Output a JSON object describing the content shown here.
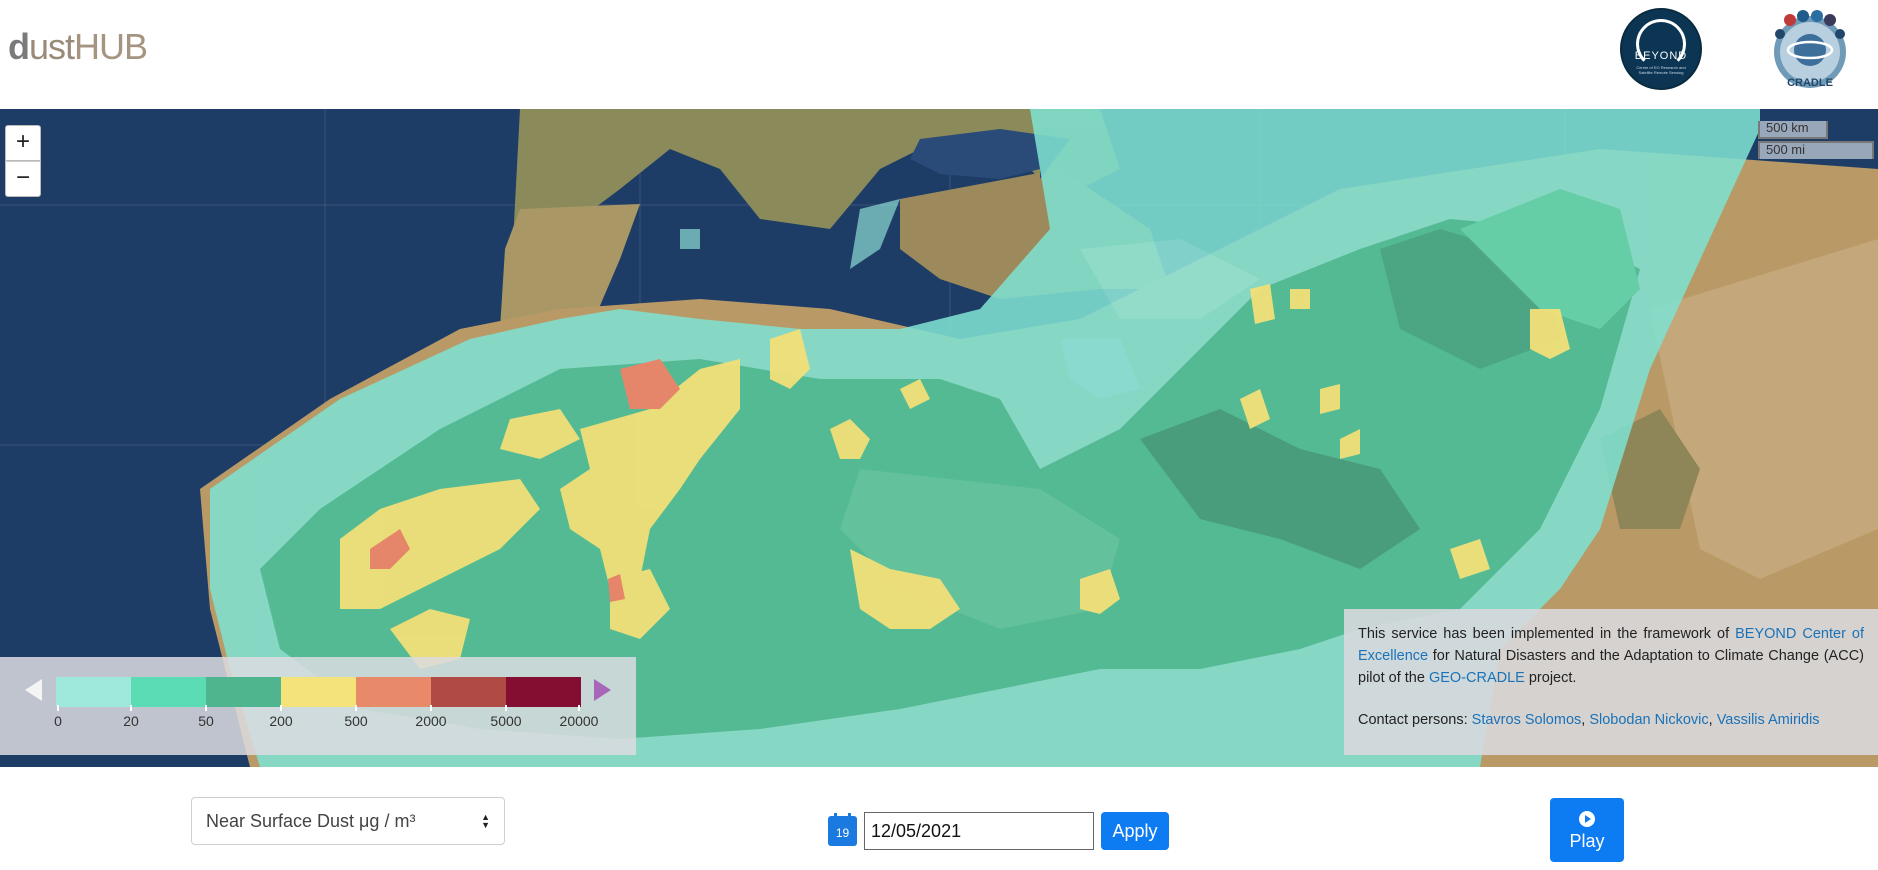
{
  "header": {
    "logo_left_d": "d",
    "logo_left_ust": "ust",
    "logo_left_hub": "HUB",
    "logo_beyond": "BEYOND",
    "logo_beyond_sub": "Centre of EO Research and Satellite Remote Sensing",
    "logo_cradle": "CRADLE"
  },
  "map": {
    "zoom_in_label": "+",
    "zoom_out_label": "−",
    "scale_km": "500 km",
    "scale_mi": "500 mi"
  },
  "legend": {
    "colors": [
      "#9ee8dc",
      "#5cdcb4",
      "#4fb58e",
      "#f4e27a",
      "#e8896a",
      "#b04a44",
      "#830e32"
    ],
    "labels": [
      "0",
      "20",
      "50",
      "200",
      "500",
      "2000",
      "5000",
      "20000"
    ]
  },
  "info": {
    "text_1": "This service has been implemented in the framework of ",
    "link_beyond": "BEYOND Center of Excellence",
    "text_2": " for Natural Disasters and the Adaptation to Climate Change (ACC) pilot of the ",
    "link_geocradle": "GEO-CRADLE",
    "text_3": " project.",
    "contact_label": "Contact persons: ",
    "contact_1": "Stavros Solomos",
    "contact_2": "Slobodan Nickovic",
    "contact_3": "Vassilis Amiridis",
    "sep": ", "
  },
  "controls": {
    "variable_selected": "Near Surface Dust μg / m³",
    "calendar_day": "19",
    "date_value": "12/05/2021",
    "apply_label": "Apply",
    "play_label": "Play"
  },
  "colors": {
    "accent": "#0d7bf2",
    "link": "#1a72b8"
  }
}
